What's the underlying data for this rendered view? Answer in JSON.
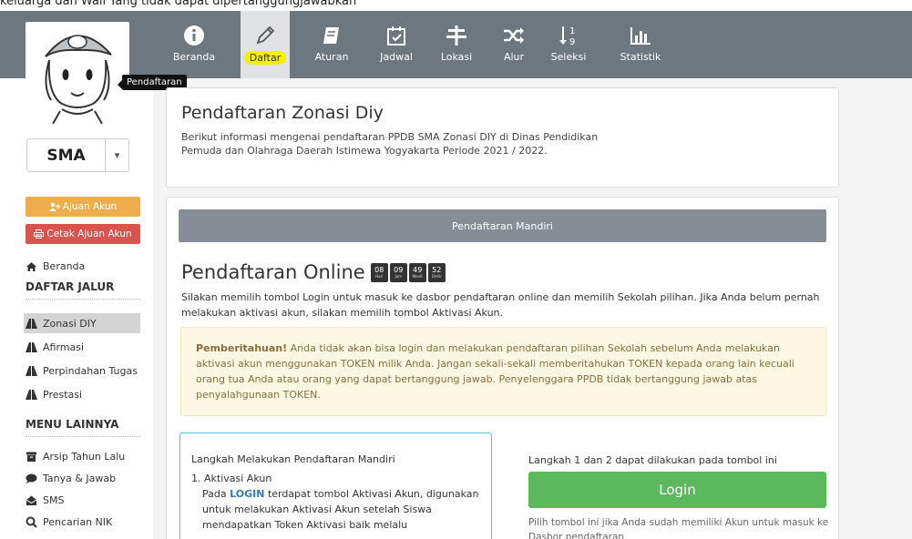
{
  "top_strip_text": "keluarga dan Wali Yang tidak dapat dipertanggungjawabkan",
  "nav": [
    {
      "label": "Beranda",
      "icon": "info-icon"
    },
    {
      "label": "Daftar",
      "icon": "pencil-icon"
    },
    {
      "label": "Aturan",
      "icon": "book-icon"
    },
    {
      "label": "Jadwal",
      "icon": "calendar-check-icon"
    },
    {
      "label": "Lokasi",
      "icon": "signpost-icon"
    },
    {
      "label": "Alur",
      "icon": "random-icon"
    },
    {
      "label": "Seleksi",
      "icon": "sort-numeric-icon"
    },
    {
      "label": "Statistik",
      "icon": "bar-chart-icon"
    }
  ],
  "tooltip": "Pendaftaran",
  "level": "SMA",
  "sidebar": {
    "ajuan_akun": "Ajuan Akun",
    "cetak_ajuan": "Cetak Ajuan Akun",
    "beranda": "Beranda",
    "daftar_jalur_head": "DAFTAR JALUR",
    "jalur": [
      "Zonasi DIY",
      "Afirmasi",
      "Perpindahan Tugas",
      "Prestasi"
    ],
    "menu_head": "MENU LAINNYA",
    "menu": [
      "Arsip Tahun Lalu",
      "Tanya & Jawab",
      "SMS",
      "Pencarian NIK"
    ]
  },
  "header_card": {
    "title": "Pendaftaran Zonasi Diy",
    "desc": "Berikut informasi mengenai pendaftaran PPDB SMA Zonasi DIY di Dinas Pendidikan Pemuda dan Olahraga Daerah Istimewa Yogyakarta Periode 2021 / 2022."
  },
  "main": {
    "bar_label": "Pendaftaran Mandiri",
    "online_title": "Pendaftaran Online",
    "countdown": [
      {
        "n": "08",
        "u": "Hari"
      },
      {
        "n": "09",
        "u": "Jam"
      },
      {
        "n": "49",
        "u": "Menit"
      },
      {
        "n": "52",
        "u": "Detik"
      }
    ],
    "intro": "Silakan memilih tombol Login untuk masuk ke dasbor pendaftaran online dan memilih Sekolah pilihan. Jika Anda belum pernah melakukan aktivasi akun, silakan memilih tombol Aktivasi Akun.",
    "alert_strong": "Pemberitahuan!",
    "alert_text": " Anda tidak akan bisa login dan melakukan pendaftaran pilihan Sekolah sebelum Anda melakukan aktivasi akun menggunakan TOKEN milik Anda. Jangan sekali-sekali memberitahukan TOKEN kepada orang lain kecuali orang tua Anda atau orang yang dapat bertanggung jawab. Penyelenggara PPDB tidak bertanggung jawab atas penyalahgunaan TOKEN.",
    "steps_title": "Langkah Melakukan Pendaftaran Mandiri",
    "step1": "1. Aktivasi Akun",
    "step1_pre": "Pada ",
    "step1_kw": "LOGIN",
    "step1_post": " terdapat tombol Aktivasi Akun, digunakan untuk melakukan Aktivasi Akun setelah Siswa mendapatkan Token Aktivasi baik melalu",
    "right_title": "Langkah 1 dan 2 dapat dilakukan pada tombol ini",
    "login_label": "Login",
    "right_note": "Pilih tombol ini jika Anda sudah memiliki Akun untuk masuk ke Dasbor pendaftaran"
  }
}
